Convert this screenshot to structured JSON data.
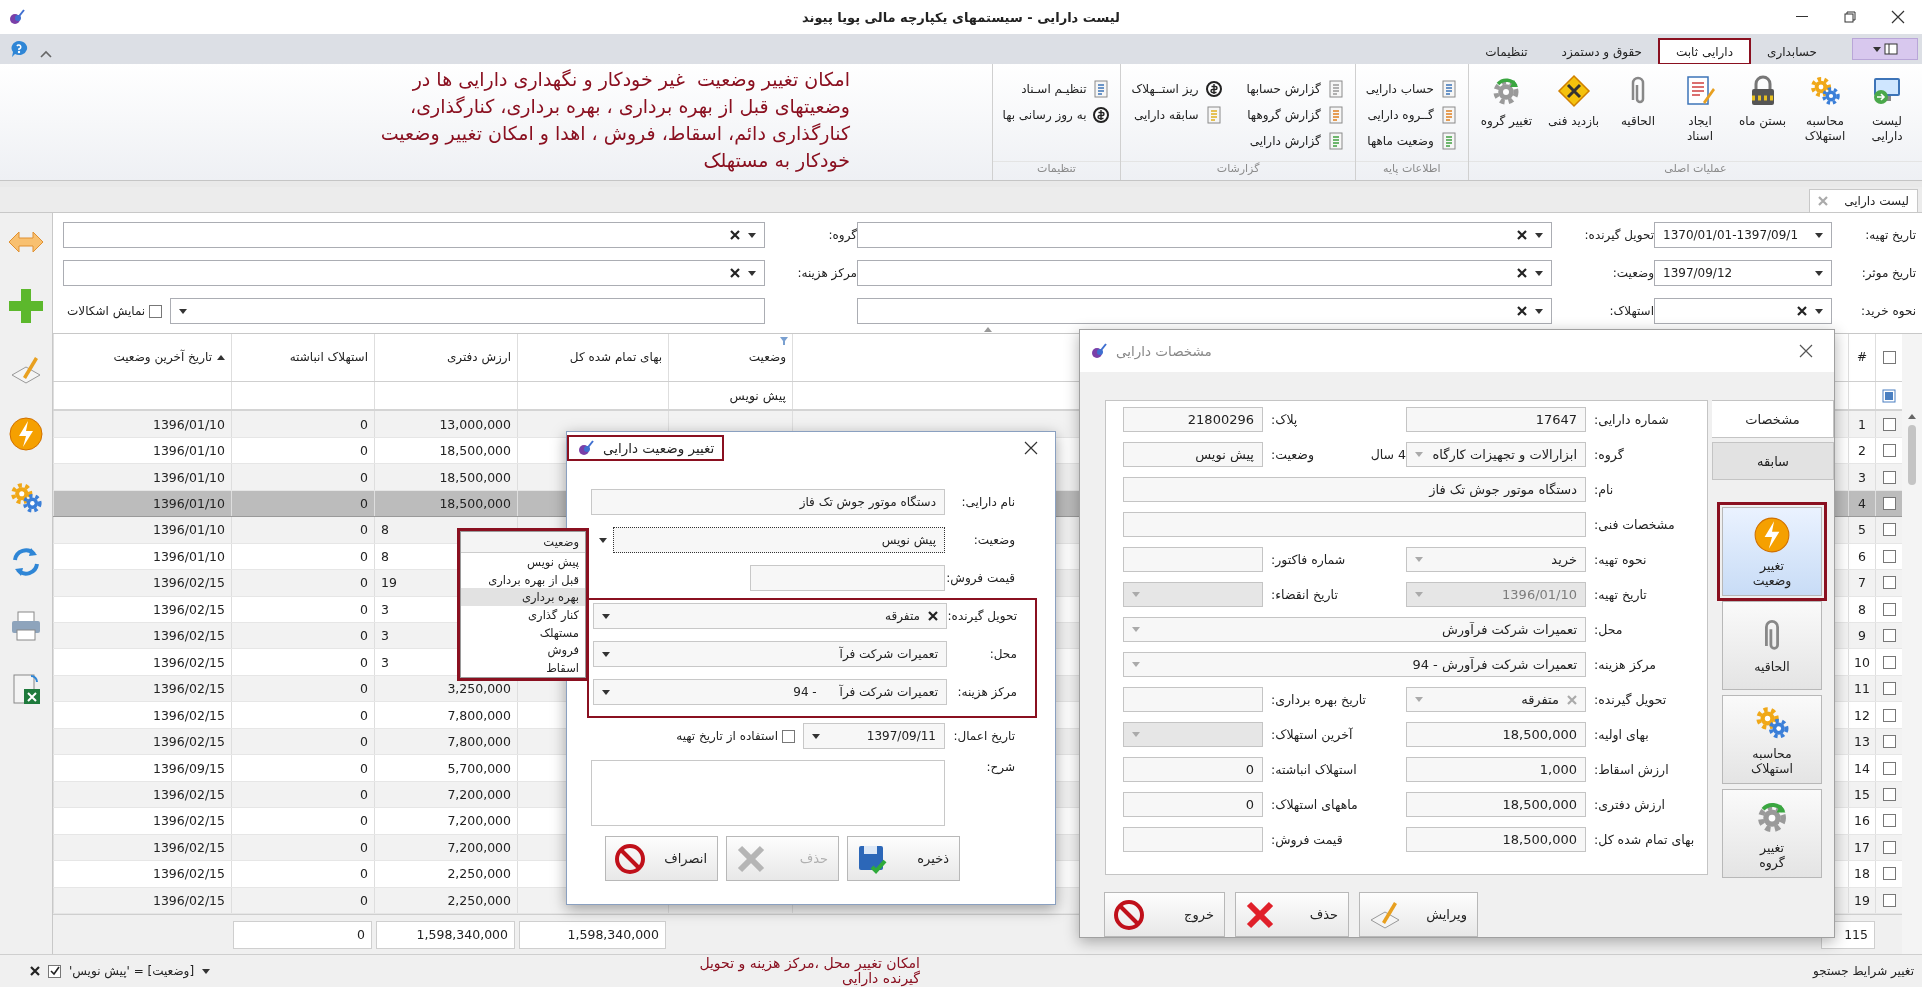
{
  "window": {
    "title": "لیست دارایی - سیستمهای یکپارچه مالی پویا پیوند"
  },
  "ribbon_tabs": [
    {
      "label": "حسابداری",
      "selected": false,
      "highlighted": false
    },
    {
      "label": "دارایی ثابت",
      "selected": true,
      "highlighted": true
    },
    {
      "label": "حقوق و دستمزد",
      "selected": false,
      "highlighted": false
    },
    {
      "label": "تنظیمات",
      "selected": false,
      "highlighted": false
    }
  ],
  "ribbon_groups": [
    {
      "title": "عملیات اصلی",
      "kind": "large",
      "items": [
        {
          "label": "لیست\nدارایی"
        },
        {
          "label": "محاسبه\nاستهلاک"
        },
        {
          "label": "بستن ماه"
        },
        {
          "label": "ایجاد\nاسناد"
        },
        {
          "label": "الحاقیه"
        },
        {
          "label": "بازدید فنی"
        },
        {
          "label": "تغییر گروه"
        }
      ]
    },
    {
      "title": "اطلاعات پایه",
      "kind": "small",
      "items": [
        {
          "label": "حساب دارایی"
        },
        {
          "label": "گــروه دارایی"
        },
        {
          "label": "وضعیت ماهها"
        }
      ]
    },
    {
      "title": "گزارشات",
      "kind": "small",
      "items": [
        {
          "label": "گزارش حسابها"
        },
        {
          "label": "گزارش گروهها"
        },
        {
          "label": "گزارش دارایی"
        },
        {
          "label": "ریز استــهلاک"
        },
        {
          "label": "سابقه دارایی"
        }
      ]
    },
    {
      "title": "تنظیمات",
      "kind": "small",
      "items": [
        {
          "label": "تنظیـم اسـناد"
        },
        {
          "label": "به روز رسانی بها"
        }
      ]
    }
  ],
  "doc_tabs": [
    {
      "label": "لیست دارایی",
      "selected": true
    }
  ],
  "filters": {
    "rows": [
      [
        {
          "label": "تاریخ تهیه:",
          "value": "1370/01/01-1397/09/1",
          "kind": "date"
        },
        {
          "label": "تحویل گیرنده:",
          "kind": "select"
        },
        {
          "label": "گروه:",
          "kind": "select"
        }
      ],
      [
        {
          "label": "تاریخ موثر:",
          "value": "1397/09/12",
          "kind": "date"
        },
        {
          "label": "وضعیت:",
          "kind": "select"
        },
        {
          "label": "مرکز هزینه:",
          "kind": "select"
        }
      ],
      [
        {
          "label": "نحوه خرید:",
          "kind": "select"
        },
        {
          "label": "استهلاک:",
          "kind": "select"
        },
        {
          "kind": "select_rtl",
          "checkbox": {
            "label": "نمایش اشکالات",
            "checked": false
          }
        }
      ]
    ]
  },
  "grid": {
    "headers": {
      "index": "#",
      "status": "وضعیت",
      "total_cost": "بهای تمام شده کل",
      "book_value": "ارزش دفتری",
      "accumulated": "استهلاک انباشته",
      "last_status_date": "تاریخ آخرین وضعیت"
    },
    "header_checked": false,
    "sort_ascending": true,
    "filter_row": {
      "status": "پیش نویس"
    },
    "rows": [
      {
        "index": "1",
        "checked": false,
        "selected": false,
        "covered": false,
        "book_value": "13,000,000",
        "accumulated": "0",
        "last_status_date": "1396/01/10"
      },
      {
        "index": "2",
        "checked": false,
        "selected": false,
        "covered": false,
        "book_value": "18,500,000",
        "accumulated": "0",
        "last_status_date": "1396/01/10"
      },
      {
        "index": "3",
        "checked": false,
        "selected": false,
        "covered": false,
        "book_value": "18,500,000",
        "accumulated": "0",
        "last_status_date": "1396/01/10"
      },
      {
        "index": "4",
        "checked": false,
        "selected": true,
        "covered": false,
        "book_value": "18,500,000",
        "accumulated": "0",
        "last_status_date": "1396/01/10"
      },
      {
        "index": "5",
        "checked": false,
        "selected": false,
        "covered": true,
        "book_value": "8",
        "accumulated": "0",
        "last_status_date": "1396/01/10"
      },
      {
        "index": "6",
        "checked": false,
        "selected": false,
        "covered": true,
        "book_value": "8",
        "accumulated": "0",
        "last_status_date": "1396/01/10"
      },
      {
        "index": "7",
        "checked": false,
        "selected": false,
        "covered": true,
        "book_value": "19",
        "accumulated": "0",
        "last_status_date": "1396/02/15"
      },
      {
        "index": "8",
        "checked": false,
        "selected": false,
        "covered": true,
        "book_value": "3",
        "accumulated": "0",
        "last_status_date": "1396/02/15"
      },
      {
        "index": "9",
        "checked": false,
        "selected": false,
        "covered": true,
        "book_value": "3",
        "accumulated": "0",
        "last_status_date": "1396/02/15"
      },
      {
        "index": "10",
        "checked": false,
        "selected": false,
        "covered": true,
        "book_value": "3",
        "accumulated": "0",
        "last_status_date": "1396/02/15"
      },
      {
        "index": "11",
        "checked": false,
        "selected": false,
        "covered": false,
        "book_value": "3,250,000",
        "accumulated": "0",
        "last_status_date": "1396/02/15"
      },
      {
        "index": "12",
        "checked": false,
        "selected": false,
        "covered": false,
        "book_value": "7,800,000",
        "accumulated": "0",
        "last_status_date": "1396/02/15"
      },
      {
        "index": "13",
        "checked": false,
        "selected": false,
        "covered": false,
        "book_value": "7,800,000",
        "accumulated": "0",
        "last_status_date": "1396/02/15"
      },
      {
        "index": "14",
        "checked": false,
        "selected": false,
        "covered": false,
        "book_value": "5,700,000",
        "accumulated": "0",
        "last_status_date": "1396/09/15"
      },
      {
        "index": "15",
        "checked": false,
        "selected": false,
        "covered": false,
        "book_value": "7,200,000",
        "accumulated": "0",
        "last_status_date": "1396/02/15"
      },
      {
        "index": "16",
        "checked": false,
        "selected": false,
        "covered": false,
        "book_value": "7,200,000",
        "accumulated": "0",
        "last_status_date": "1396/02/15"
      },
      {
        "index": "17",
        "checked": false,
        "selected": false,
        "covered": false,
        "book_value": "7,200,000",
        "accumulated": "0",
        "last_status_date": "1396/02/15"
      },
      {
        "index": "18",
        "checked": false,
        "selected": false,
        "covered": false,
        "book_value": "2,250,000",
        "accumulated": "0",
        "last_status_date": "1396/02/15"
      },
      {
        "index": "19",
        "checked": false,
        "selected": false,
        "covered": false,
        "book_value": "2,250,000",
        "accumulated": "0",
        "last_status_date": "1396/02/15"
      }
    ],
    "totals": {
      "count": "115",
      "total_cost": "1,598,340,000",
      "book_value": "1,598,340,000",
      "accumulated": "0"
    }
  },
  "status_bar": {
    "filter": {
      "text": "[وضعیت] = 'پیش نویس'",
      "checked": true
    },
    "link": "تغییر شرایط جستجو"
  },
  "annotations": [
    {
      "text": "امکان تغییر وضعیت  غیر خودکار و نگهداری دارایی ها در\nوضعیتهای قبل از بهره برداری ، بهره برداری، کنارگذاری،\nکنارگذاری دائم، اسقاط، فروش ، اهدا و امکان تغییر وضعیت\nخودکار به مستهلک"
    },
    {
      "text": "امکان تغییر محل ،مرکز هزینه و تحویل\nگیرنده دارایی"
    }
  ],
  "asset_dialog": {
    "title": "مشخصات دارایی",
    "side_tabs": [
      {
        "label": "مشخصات",
        "selected": true
      },
      {
        "label": "سابقه",
        "selected": false
      }
    ],
    "rows": [
      [
        {
          "label": "شماره دارایی:",
          "value": "17647",
          "kind": "text",
          "disabled": false
        },
        {
          "label": "پلاک:",
          "value": "21800296",
          "kind": "text",
          "disabled": false
        }
      ],
      [
        {
          "label": "گروه:",
          "value": "ابزارالات و تجهیزات کارگاه",
          "kind": "select",
          "suffix": "4 سال",
          "disabled": false
        },
        {
          "label": "وضعیت:",
          "value": "پیش نویس",
          "kind": "text",
          "disabled": false
        }
      ],
      [
        {
          "label": "نام:",
          "value": "دستگاه موتور جوش تک فاز",
          "kind": "wide_text",
          "disabled": false
        }
      ],
      [
        {
          "label": "مشخصات فنی:",
          "kind": "wide_text",
          "disabled": false
        }
      ],
      [
        {
          "label": "نحوه تهیه:",
          "value": "خرید",
          "kind": "select",
          "disabled": false
        },
        {
          "label": "شماره فاکتور:",
          "kind": "text",
          "disabled": false
        }
      ],
      [
        {
          "label": "تاریخ تهیه:",
          "value": "1396/01/10",
          "kind": "select",
          "disabled": true
        },
        {
          "label": "تاریخ انقضاء:",
          "kind": "select",
          "disabled": true
        }
      ],
      [
        {
          "label": "محل:",
          "value": "تعمیرات شرکت فرآورش",
          "kind": "wide_select",
          "disabled": false
        }
      ],
      [
        {
          "label": "مرکز هزینه:",
          "value": "تعمیرات شرکت فرآورش - 94",
          "kind": "wide_select",
          "disabled": false
        }
      ],
      [
        {
          "label": "تحویل گیرنده:",
          "value": "متفرقه",
          "kind": "select_clear",
          "disabled": false
        },
        {
          "label": "تاریخ بهره برداری:",
          "kind": "text",
          "disabled": false
        }
      ],
      [
        {
          "label": "بهای اولیه:",
          "value": "18,500,000",
          "kind": "text",
          "disabled": false
        },
        {
          "label": "آخرین استهلاک:",
          "kind": "select",
          "disabled": true
        }
      ],
      [
        {
          "label": "ارزش اسقاط:",
          "value": "1,000",
          "kind": "text",
          "disabled": false
        },
        {
          "label": "استهلاک انباشته:",
          "value": "0",
          "kind": "text",
          "disabled": false
        }
      ],
      [
        {
          "label": "ارزش دفتری:",
          "value": "18,500,000",
          "kind": "text",
          "disabled": false
        },
        {
          "label": "ماههای استهلاک:",
          "value": "0",
          "kind": "text",
          "disabled": false
        }
      ],
      [
        {
          "label": "بهای تمام شده کل:",
          "value": "18,500,000",
          "kind": "text",
          "disabled": false
        },
        {
          "label": "قیمت فروش:",
          "kind": "text",
          "disabled": false
        }
      ]
    ],
    "side_buttons": [
      {
        "label": "تغییر\nوضعیت",
        "highlighted": true
      },
      {
        "label": "الحاقیه",
        "highlighted": false
      },
      {
        "label": "محاسبه\nاستهلاک",
        "highlighted": false
      },
      {
        "label": "تغییر\nگروه",
        "highlighted": false
      }
    ],
    "buttons": [
      {
        "label": "ویرایش"
      },
      {
        "label": "حذف"
      },
      {
        "label": "خروج"
      }
    ]
  },
  "status_dialog": {
    "title": "تغییر وضعیت دارایی",
    "title_highlighted": true,
    "fields": [
      {
        "label": "نام دارایی:",
        "value": "دستگاه موتور جوش تک فاز",
        "kind": "text",
        "highlighted": false
      },
      {
        "label": "وضعیت:",
        "value": "پیش نویس",
        "kind": "dropdown",
        "highlighted": false
      },
      {
        "label": "قیمت فروش:",
        "kind": "short",
        "highlighted": false
      },
      {
        "label": "تحویل گیرنده:",
        "value": "متفرقه",
        "kind": "select_clear",
        "highlighted": true
      },
      {
        "label": "محل:",
        "value": "تعمیرات شرکت فرآ",
        "kind": "select",
        "highlighted": true
      },
      {
        "label": "مرکز هزینه:",
        "value": "تعمیرات شرکت فرآ      - 94",
        "kind": "select",
        "highlighted": true
      },
      {
        "label": "تاریخ اعمال:",
        "value": "1397/09/11",
        "kind": "date",
        "checkbox": {
          "label": "استفاده از تاریخ تهیه",
          "checked": false
        },
        "highlighted": false
      },
      {
        "label": "شرح:",
        "kind": "memo",
        "highlighted": false
      }
    ],
    "dropdown": {
      "open": true,
      "highlighted": true,
      "header": "وضعیت",
      "options": [
        {
          "label": "پیش نویس",
          "selected": false
        },
        {
          "label": "قبل از بهره برداری",
          "selected": false
        },
        {
          "label": "بهره برداری",
          "selected": true
        },
        {
          "label": "کنار گذاری",
          "selected": false
        },
        {
          "label": "مستهلک",
          "selected": false
        },
        {
          "label": "فروش",
          "selected": false
        },
        {
          "label": "اسقاط",
          "selected": false
        }
      ]
    },
    "buttons": [
      {
        "label": "ذخیره",
        "disabled": false
      },
      {
        "label": "حذف",
        "disabled": true
      },
      {
        "label": "انصراف",
        "disabled": false
      }
    ]
  }
}
